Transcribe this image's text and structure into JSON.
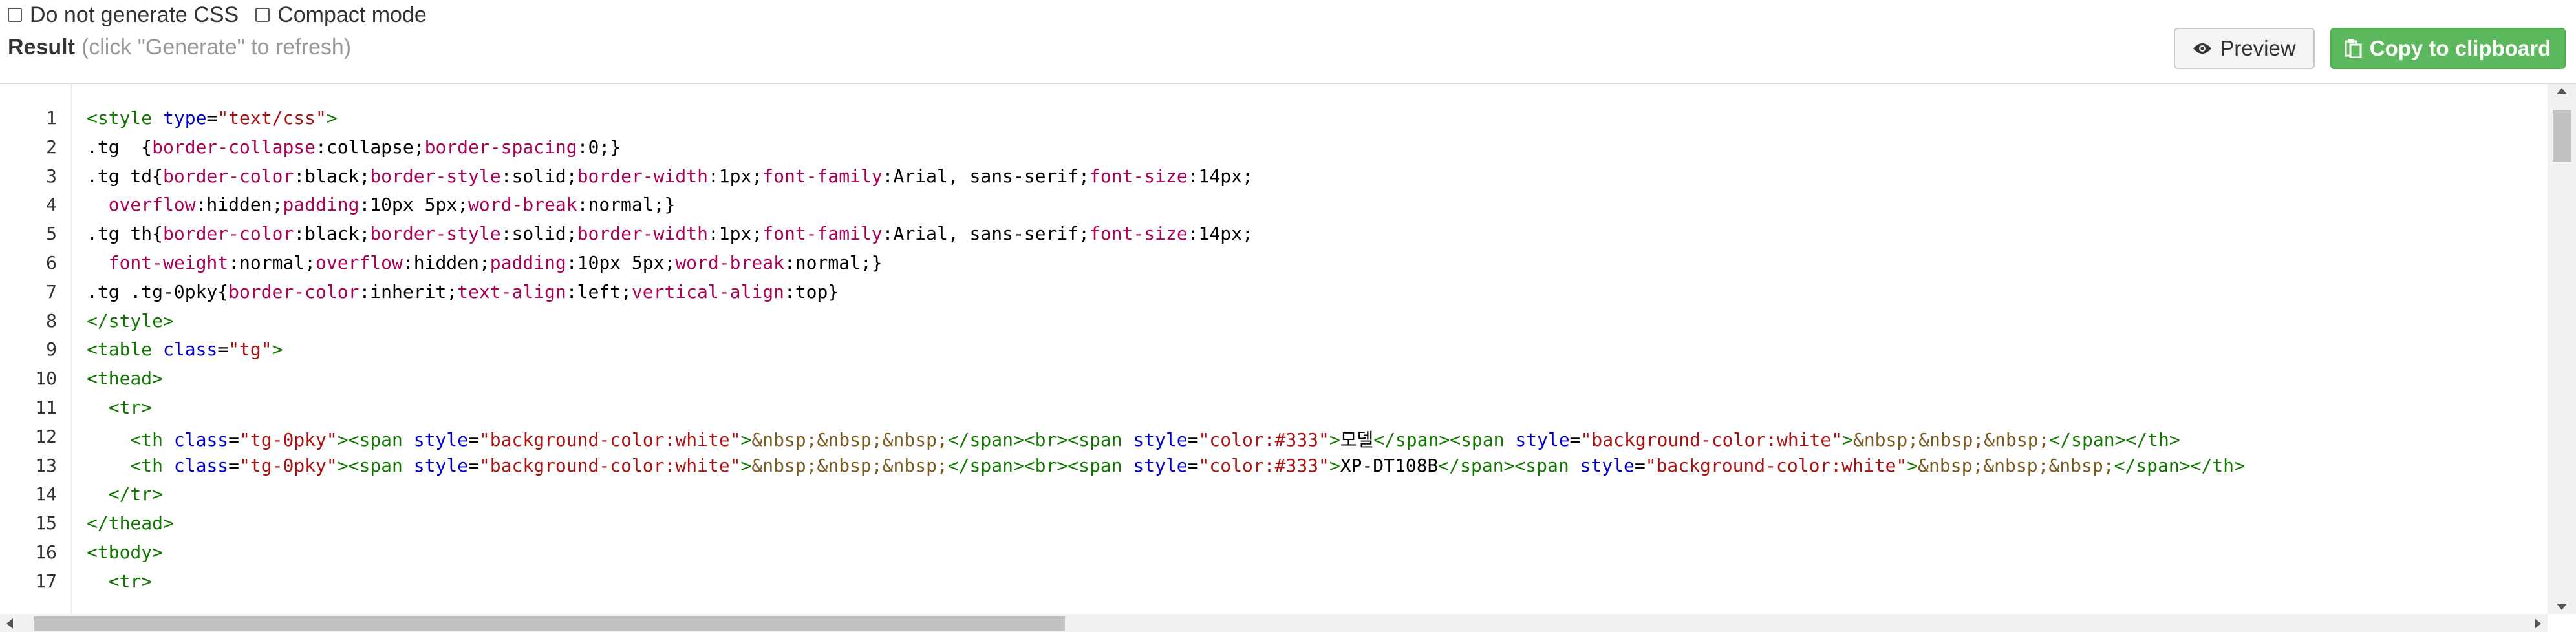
{
  "options": {
    "no_css_label": "Do not generate CSS",
    "compact_label": "Compact mode"
  },
  "result": {
    "title": "Result",
    "hint": "(click \"Generate\" to refresh)"
  },
  "buttons": {
    "preview_label": "Preview",
    "copy_label": "Copy to clipboard",
    "preview_icon": "eye-icon",
    "copy_icon": "clipboard-icon"
  },
  "colors": {
    "copy_button": "#5cb85c",
    "tag": "#117700",
    "attribute": "#0000cc",
    "string": "#aa1111",
    "property": "#aa0055"
  },
  "line_numbers": [
    "1",
    "2",
    "3",
    "4",
    "5",
    "6",
    "7",
    "8",
    "9",
    "10",
    "11",
    "12",
    "13",
    "14",
    "15",
    "16",
    "17"
  ],
  "code_lines": [
    [
      {
        "t": "tag",
        "v": "<style"
      },
      {
        "t": "txt",
        "v": " "
      },
      {
        "t": "attr",
        "v": "type"
      },
      {
        "t": "txt",
        "v": "="
      },
      {
        "t": "str",
        "v": "\"text/css\""
      },
      {
        "t": "tag",
        "v": ">"
      }
    ],
    [
      {
        "t": "sel",
        "v": ".tg  {"
      },
      {
        "t": "prop",
        "v": "border-collapse"
      },
      {
        "t": "txt",
        "v": ":collapse;"
      },
      {
        "t": "prop",
        "v": "border-spacing"
      },
      {
        "t": "txt",
        "v": ":0;}"
      }
    ],
    [
      {
        "t": "sel",
        "v": ".tg td{"
      },
      {
        "t": "prop",
        "v": "border-color"
      },
      {
        "t": "txt",
        "v": ":black;"
      },
      {
        "t": "prop",
        "v": "border-style"
      },
      {
        "t": "txt",
        "v": ":solid;"
      },
      {
        "t": "prop",
        "v": "border-width"
      },
      {
        "t": "txt",
        "v": ":1px;"
      },
      {
        "t": "prop",
        "v": "font-family"
      },
      {
        "t": "txt",
        "v": ":Arial, sans-serif;"
      },
      {
        "t": "prop",
        "v": "font-size"
      },
      {
        "t": "txt",
        "v": ":14px;"
      }
    ],
    [
      {
        "t": "txt",
        "v": "  "
      },
      {
        "t": "prop",
        "v": "overflow"
      },
      {
        "t": "txt",
        "v": ":hidden;"
      },
      {
        "t": "prop",
        "v": "padding"
      },
      {
        "t": "txt",
        "v": ":10px 5px;"
      },
      {
        "t": "prop",
        "v": "word-break"
      },
      {
        "t": "txt",
        "v": ":normal;}"
      }
    ],
    [
      {
        "t": "sel",
        "v": ".tg th{"
      },
      {
        "t": "prop",
        "v": "border-color"
      },
      {
        "t": "txt",
        "v": ":black;"
      },
      {
        "t": "prop",
        "v": "border-style"
      },
      {
        "t": "txt",
        "v": ":solid;"
      },
      {
        "t": "prop",
        "v": "border-width"
      },
      {
        "t": "txt",
        "v": ":1px;"
      },
      {
        "t": "prop",
        "v": "font-family"
      },
      {
        "t": "txt",
        "v": ":Arial, sans-serif;"
      },
      {
        "t": "prop",
        "v": "font-size"
      },
      {
        "t": "txt",
        "v": ":14px;"
      }
    ],
    [
      {
        "t": "txt",
        "v": "  "
      },
      {
        "t": "prop",
        "v": "font-weight"
      },
      {
        "t": "txt",
        "v": ":normal;"
      },
      {
        "t": "prop",
        "v": "overflow"
      },
      {
        "t": "txt",
        "v": ":hidden;"
      },
      {
        "t": "prop",
        "v": "padding"
      },
      {
        "t": "txt",
        "v": ":10px 5px;"
      },
      {
        "t": "prop",
        "v": "word-break"
      },
      {
        "t": "txt",
        "v": ":normal;}"
      }
    ],
    [
      {
        "t": "sel",
        "v": ".tg .tg-0pky{"
      },
      {
        "t": "prop",
        "v": "border-color"
      },
      {
        "t": "txt",
        "v": ":inherit;"
      },
      {
        "t": "prop",
        "v": "text-align"
      },
      {
        "t": "txt",
        "v": ":left;"
      },
      {
        "t": "prop",
        "v": "vertical-align"
      },
      {
        "t": "txt",
        "v": ":top}"
      }
    ],
    [
      {
        "t": "tag",
        "v": "</style>"
      }
    ],
    [
      {
        "t": "tag",
        "v": "<table"
      },
      {
        "t": "txt",
        "v": " "
      },
      {
        "t": "attr",
        "v": "class"
      },
      {
        "t": "txt",
        "v": "="
      },
      {
        "t": "str",
        "v": "\"tg\""
      },
      {
        "t": "tag",
        "v": ">"
      }
    ],
    [
      {
        "t": "tag",
        "v": "<thead>"
      }
    ],
    [
      {
        "t": "txt",
        "v": "  "
      },
      {
        "t": "tag",
        "v": "<tr>"
      }
    ],
    [
      {
        "t": "txt",
        "v": "    "
      },
      {
        "t": "tag",
        "v": "<th"
      },
      {
        "t": "txt",
        "v": " "
      },
      {
        "t": "attr",
        "v": "class"
      },
      {
        "t": "txt",
        "v": "="
      },
      {
        "t": "str",
        "v": "\"tg-0pky\""
      },
      {
        "t": "tag",
        "v": "><span"
      },
      {
        "t": "txt",
        "v": " "
      },
      {
        "t": "attr",
        "v": "style"
      },
      {
        "t": "txt",
        "v": "="
      },
      {
        "t": "str",
        "v": "\"background-color:white\""
      },
      {
        "t": "tag",
        "v": ">"
      },
      {
        "t": "ent",
        "v": "&nbsp;&nbsp;&nbsp;"
      },
      {
        "t": "tag",
        "v": "</span><br><span"
      },
      {
        "t": "txt",
        "v": " "
      },
      {
        "t": "attr",
        "v": "style"
      },
      {
        "t": "txt",
        "v": "="
      },
      {
        "t": "str",
        "v": "\"color:#333\""
      },
      {
        "t": "tag",
        "v": ">"
      },
      {
        "t": "txt",
        "v": "모델"
      },
      {
        "t": "tag",
        "v": "</span><span"
      },
      {
        "t": "txt",
        "v": " "
      },
      {
        "t": "attr",
        "v": "style"
      },
      {
        "t": "txt",
        "v": "="
      },
      {
        "t": "str",
        "v": "\"background-color:white\""
      },
      {
        "t": "tag",
        "v": ">"
      },
      {
        "t": "ent",
        "v": "&nbsp;&nbsp;&nbsp;"
      },
      {
        "t": "tag",
        "v": "</span></th>"
      }
    ],
    [
      {
        "t": "txt",
        "v": "    "
      },
      {
        "t": "tag",
        "v": "<th"
      },
      {
        "t": "txt",
        "v": " "
      },
      {
        "t": "attr",
        "v": "class"
      },
      {
        "t": "txt",
        "v": "="
      },
      {
        "t": "str",
        "v": "\"tg-0pky\""
      },
      {
        "t": "tag",
        "v": "><span"
      },
      {
        "t": "txt",
        "v": " "
      },
      {
        "t": "attr",
        "v": "style"
      },
      {
        "t": "txt",
        "v": "="
      },
      {
        "t": "str",
        "v": "\"background-color:white\""
      },
      {
        "t": "tag",
        "v": ">"
      },
      {
        "t": "ent",
        "v": "&nbsp;&nbsp;&nbsp;"
      },
      {
        "t": "tag",
        "v": "</span><br><span"
      },
      {
        "t": "txt",
        "v": " "
      },
      {
        "t": "attr",
        "v": "style"
      },
      {
        "t": "txt",
        "v": "="
      },
      {
        "t": "str",
        "v": "\"color:#333\""
      },
      {
        "t": "tag",
        "v": ">"
      },
      {
        "t": "txt",
        "v": "XP-DT108B"
      },
      {
        "t": "tag",
        "v": "</span><span"
      },
      {
        "t": "txt",
        "v": " "
      },
      {
        "t": "attr",
        "v": "style"
      },
      {
        "t": "txt",
        "v": "="
      },
      {
        "t": "str",
        "v": "\"background-color:white\""
      },
      {
        "t": "tag",
        "v": ">"
      },
      {
        "t": "ent",
        "v": "&nbsp;&nbsp;&nbsp;"
      },
      {
        "t": "tag",
        "v": "</span></th>"
      }
    ],
    [
      {
        "t": "txt",
        "v": "  "
      },
      {
        "t": "tag",
        "v": "</tr>"
      }
    ],
    [
      {
        "t": "tag",
        "v": "</thead>"
      }
    ],
    [
      {
        "t": "tag",
        "v": "<tbody>"
      }
    ],
    [
      {
        "t": "txt",
        "v": "  "
      },
      {
        "t": "tag",
        "v": "<tr>"
      }
    ]
  ]
}
